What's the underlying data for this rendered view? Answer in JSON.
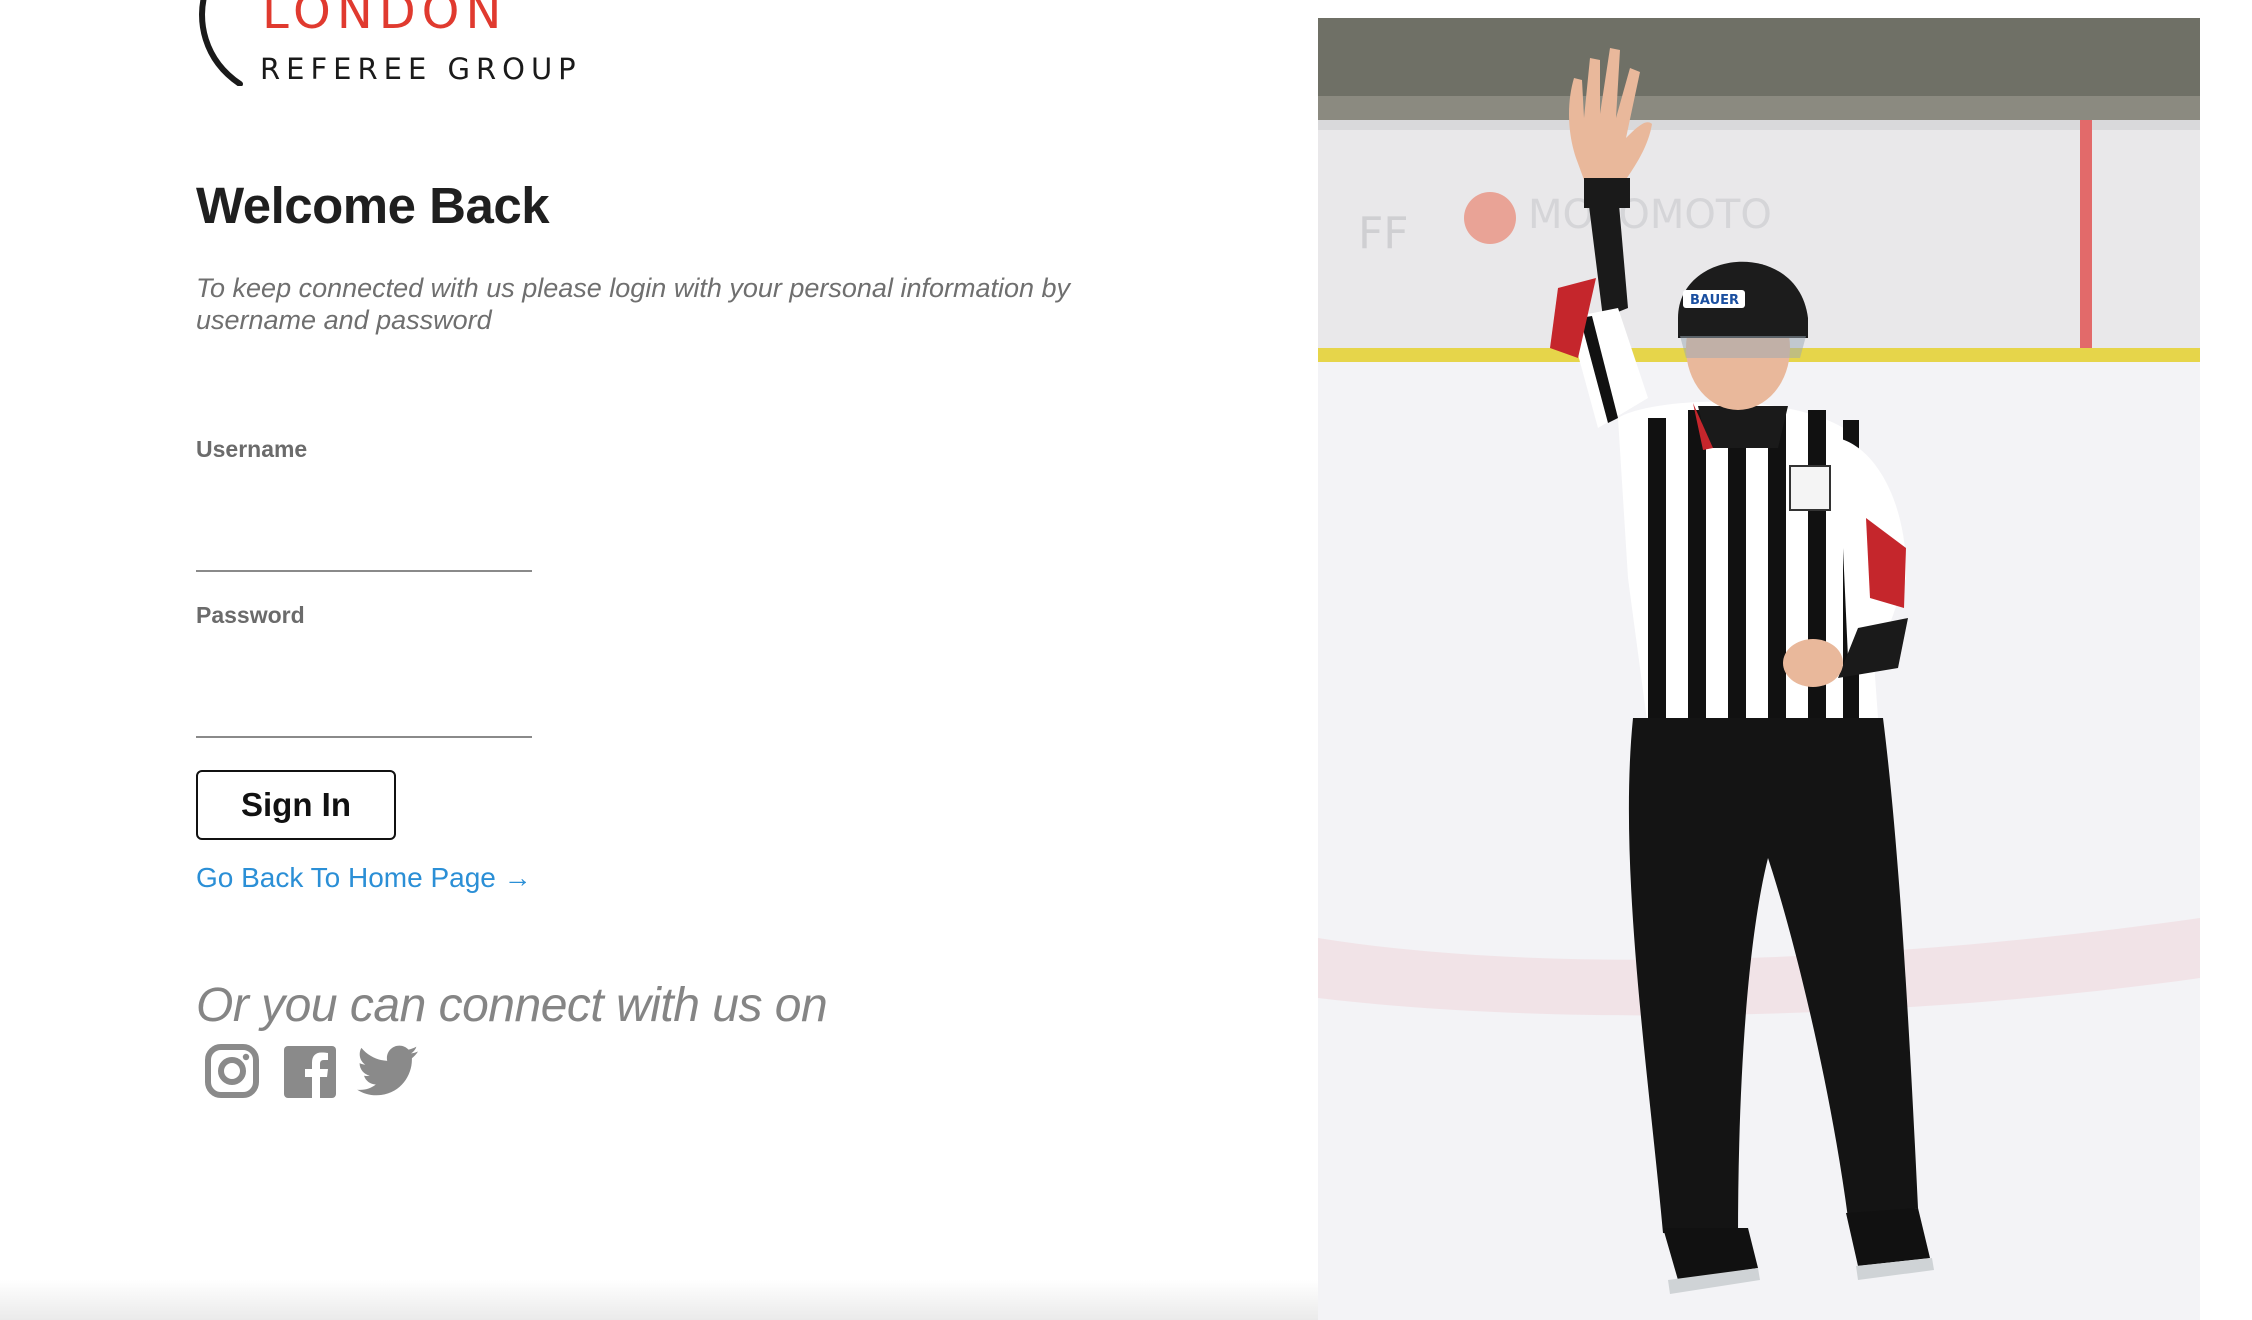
{
  "logo": {
    "line1": "LONDON",
    "line2": "REFEREE GROUP",
    "accent_color": "#e03a2f"
  },
  "login": {
    "heading": "Welcome Back",
    "subtitle": "To keep connected with us please login with your personal information by username and password",
    "username_label": "Username",
    "username_value": "",
    "password_label": "Password",
    "password_value": "",
    "signin_label": "Sign In",
    "home_link": "Go Back To Home Page →",
    "link_color": "#2b8fd6"
  },
  "social": {
    "heading": "Or you can connect with us on",
    "icons": [
      "instagram-icon",
      "facebook-icon",
      "twitter-icon"
    ]
  },
  "photo": {
    "helmet_brand": "BAUER",
    "subject": "hockey referee raising hand on ice rink"
  }
}
